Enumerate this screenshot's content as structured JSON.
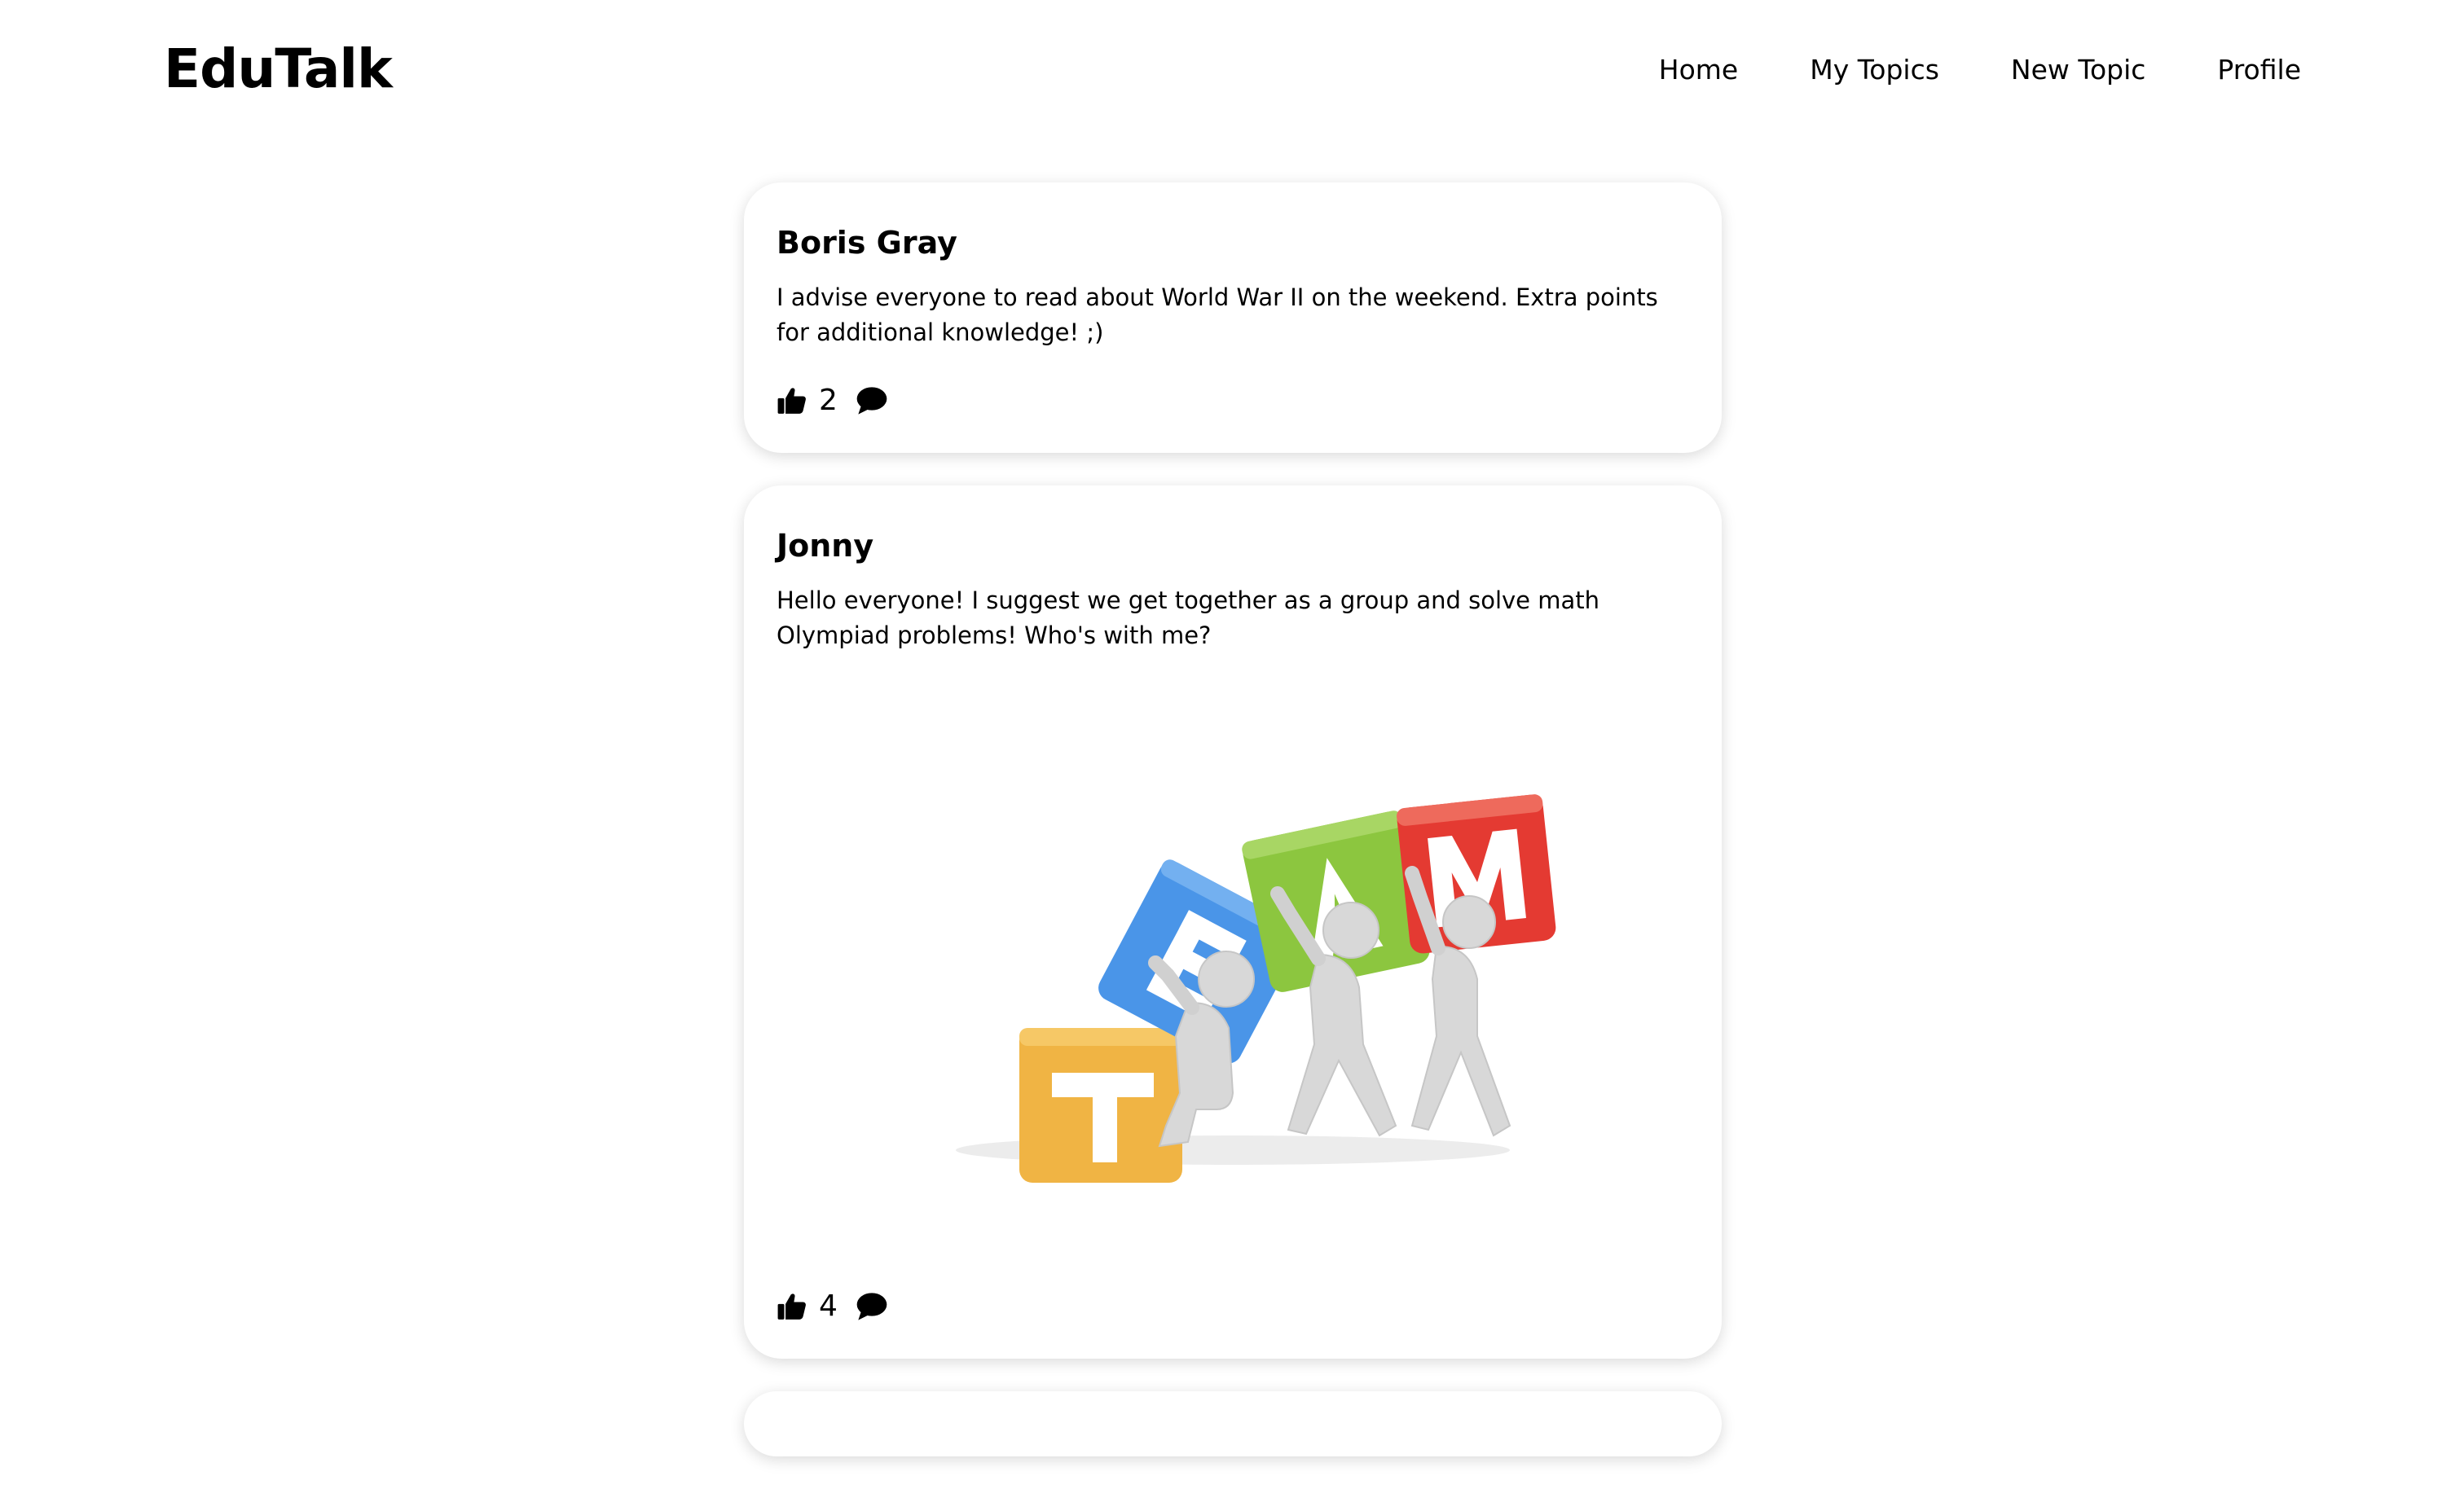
{
  "app": {
    "logo": "EduTalk"
  },
  "nav": {
    "items": [
      {
        "label": "Home"
      },
      {
        "label": "My Topics"
      },
      {
        "label": "New Topic"
      },
      {
        "label": "Profile"
      }
    ]
  },
  "posts": [
    {
      "author": "Boris Gray",
      "text": "I advise everyone to read about World War II on the weekend. Extra points for additional knowledge! ;)",
      "likes": "2",
      "like_icon": "thumbs-up-icon",
      "comment_icon": "comment-icon"
    },
    {
      "author": "Jonny",
      "text": "Hello everyone! I suggest we get together as a group and solve math Olympiad problems! Who's with me?",
      "image": {
        "letters": [
          "T",
          "E",
          "A",
          "M"
        ],
        "colors": [
          "#f0b444",
          "#4a95e8",
          "#8cc63f",
          "#e43a32"
        ]
      },
      "likes": "4",
      "like_icon": "thumbs-up-icon",
      "comment_icon": "comment-icon"
    }
  ]
}
